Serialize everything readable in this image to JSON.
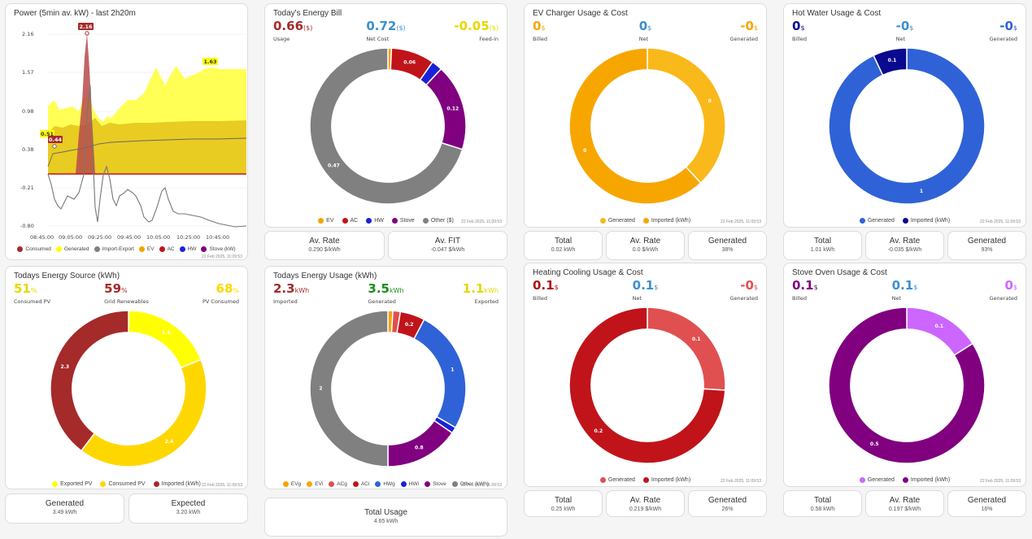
{
  "power": {
    "title": "Power (5min av. kW) - last 2h20m",
    "yticks": [
      "2.16",
      "1.57",
      "0.98",
      "0.38",
      "-0.21",
      "-0.80"
    ],
    "xticks": [
      "08:45:00",
      "09:05:00",
      "09:25:00",
      "09:45:00",
      "10:05:00",
      "10:25:00",
      "10:45:00"
    ],
    "callouts": [
      "2.16",
      "1.63",
      "0.51",
      "0.44"
    ],
    "legend": [
      "Consumed",
      "Generated",
      "Import-Export",
      "EV",
      "AC",
      "HW",
      "Stove (kW)"
    ],
    "timestamp": "22 Feb 2025, 11:09:53"
  },
  "bill": {
    "title": "Today's Energy Bill",
    "usage": {
      "value": "0.66",
      "unit": "($)",
      "label": "Usage"
    },
    "net": {
      "value": "0.72",
      "unit": "($)",
      "label": "Net Cost"
    },
    "feedin": {
      "value": "-0.05",
      "unit": "($)",
      "label": "Feed-in"
    },
    "slices": [
      {
        "label": "",
        "value": 0.005,
        "color": "#f5a300"
      },
      {
        "label": "0.06",
        "value": 0.06,
        "color": "#c0141a"
      },
      {
        "label": "",
        "value": 0.015,
        "color": "#1a22d6"
      },
      {
        "label": "0.12",
        "value": 0.12,
        "color": "#800080"
      },
      {
        "label": "0.47",
        "value": 0.47,
        "color": "#808080"
      }
    ],
    "legend": [
      "EV",
      "AC",
      "HW",
      "Stove",
      "Other ($)"
    ],
    "timestamp": "22 Feb 2025, 11:09:53"
  },
  "ev": {
    "title": "EV Charger Usage & Cost",
    "billed": {
      "value": "0",
      "unit": "$",
      "label": "Billed"
    },
    "net": {
      "value": "0",
      "unit": "$",
      "label": "Net"
    },
    "generated": {
      "value": "-0",
      "unit": "$",
      "label": "Generated"
    },
    "slices": [
      {
        "label": "0",
        "value": 0.38,
        "color": "#f9b91a"
      },
      {
        "label": "0",
        "value": 0.62,
        "color": "#f7a600"
      }
    ],
    "legend": [
      "Generated",
      "Imported (kWh)"
    ],
    "timestamp": "22 Feb 2025, 11:09:53"
  },
  "hw": {
    "title": "Hot Water Usage & Cost",
    "billed": {
      "value": "0",
      "unit": "$",
      "label": "Billed"
    },
    "net": {
      "value": "-0",
      "unit": "$",
      "label": "Net"
    },
    "generated": {
      "value": "-0",
      "unit": "$",
      "label": "Generated"
    },
    "slices": [
      {
        "label": "1",
        "value": 0.93,
        "color": "#2f62d6"
      },
      {
        "label": "0.1",
        "value": 0.07,
        "color": "#0a0a8f"
      }
    ],
    "legend": [
      "Generated",
      "Imported (kWh)"
    ],
    "timestamp": "22 Feb 2025, 11:09:53"
  },
  "source": {
    "title": "Todays Energy Source (kWh)",
    "consumedpv": {
      "value": "51",
      "unit": "%",
      "label": "Consumed PV"
    },
    "grid": {
      "value": "59",
      "unit": "%",
      "label": "Grid Renewables"
    },
    "pvconsumed": {
      "value": "68",
      "unit": "%",
      "label": "PV Consumed"
    },
    "slices": [
      {
        "label": "1.1",
        "value": 1.1,
        "color": "#ffff00"
      },
      {
        "label": "2.4",
        "value": 2.4,
        "color": "#ffd700"
      },
      {
        "label": "2.3",
        "value": 2.3,
        "color": "#a52a2a"
      }
    ],
    "legend": [
      "Exported PV",
      "Consumed PV",
      "Imported (kWh)"
    ],
    "timestamp": "22 Feb 2025, 11:09:53"
  },
  "usage": {
    "title": "Todays Energy Usage (kWh)",
    "imported": {
      "value": "2.3",
      "unit": "kWh",
      "label": "Imported"
    },
    "generated": {
      "value": "3.5",
      "unit": "kWh",
      "label": "Generated"
    },
    "exported": {
      "value": "1.1",
      "unit": "kWh",
      "label": "Exported"
    },
    "slices": [
      {
        "label": "",
        "value": 0.04,
        "color": "#f5a300"
      },
      {
        "label": "",
        "value": 0.06,
        "color": "#e05050"
      },
      {
        "label": "0.2",
        "value": 0.2,
        "color": "#c0141a"
      },
      {
        "label": "1",
        "value": 1.0,
        "color": "#2f62d6"
      },
      {
        "label": "",
        "value": 0.05,
        "color": "#1a22d6"
      },
      {
        "label": "0.8",
        "value": 0.6,
        "color": "#800080"
      },
      {
        "label": "2",
        "value": 1.95,
        "color": "#808080"
      }
    ],
    "legend": [
      "EVg",
      "EVi",
      "ACg",
      "ACi",
      "HWg",
      "HWi",
      "Stove",
      "Other (kWh)"
    ],
    "timestamp": "22 Feb 2025, 11:09:53"
  },
  "hc": {
    "title": "Heating Cooling Usage & Cost",
    "billed": {
      "value": "0.1",
      "unit": "$",
      "label": "Billed"
    },
    "net": {
      "value": "0.1",
      "unit": "$",
      "label": "Net"
    },
    "generated": {
      "value": "-0",
      "unit": "$",
      "label": "Generated"
    },
    "slices": [
      {
        "label": "0.1",
        "value": 0.26,
        "color": "#e05050"
      },
      {
        "label": "0.2",
        "value": 0.74,
        "color": "#c0141a"
      }
    ],
    "legend": [
      "Generated",
      "Imported (kWh)"
    ],
    "timestamp": "22 Feb 2025, 11:09:53"
  },
  "stove": {
    "title": "Stove Oven Usage & Cost",
    "billed": {
      "value": "0.1",
      "unit": "$",
      "label": "Billed"
    },
    "net": {
      "value": "0.1",
      "unit": "$",
      "label": "Net"
    },
    "generated": {
      "value": "0",
      "unit": "$",
      "label": "Generated"
    },
    "slices": [
      {
        "label": "0.1",
        "value": 0.16,
        "color": "#cc66ff"
      },
      {
        "label": "0.5",
        "value": 0.84,
        "color": "#800080"
      }
    ],
    "legend": [
      "Generated",
      "Imported (kWh)"
    ],
    "timestamp": "22 Feb 2025, 11:09:53"
  },
  "tiles": {
    "bill": [
      {
        "t": "Av. Rate",
        "v": "0.290 $/kWh"
      },
      {
        "t": "Av. FIT",
        "v": "-0.047 $/kWh"
      }
    ],
    "ev": [
      {
        "t": "Total",
        "v": "0.02 kWh"
      },
      {
        "t": "Av. Rate",
        "v": "0.0 $/kWh"
      },
      {
        "t": "Generated",
        "v": "38%"
      }
    ],
    "hw": [
      {
        "t": "Total",
        "v": "1.01 kWh"
      },
      {
        "t": "Av. Rate",
        "v": "-0.035 $/kWh"
      },
      {
        "t": "Generated",
        "v": "93%"
      }
    ],
    "source": [
      {
        "t": "Generated",
        "v": "3.49 kWh"
      },
      {
        "t": "Expected",
        "v": "3.20 kWh"
      }
    ],
    "usage": [
      {
        "t": "Total Usage",
        "v": "4.65 kWh"
      }
    ],
    "hc": [
      {
        "t": "Total",
        "v": "0.25 kWh"
      },
      {
        "t": "Av. Rate",
        "v": "0.219 $/kWh"
      },
      {
        "t": "Generated",
        "v": "26%"
      }
    ],
    "stove": [
      {
        "t": "Total",
        "v": "0.58 kWh"
      },
      {
        "t": "Av. Rate",
        "v": "0.197 $/kWh"
      },
      {
        "t": "Generated",
        "v": "16%"
      }
    ]
  },
  "colors": {
    "red": "#a52a2a",
    "blue": "#3a8fd0",
    "yellow": "#e5d800",
    "green": "#1a8c1a",
    "gold": "#f7a600",
    "navy": "#0a0a8f",
    "crimson": "#b01010",
    "purple": "#800080",
    "lavender": "#cc66ff"
  }
}
